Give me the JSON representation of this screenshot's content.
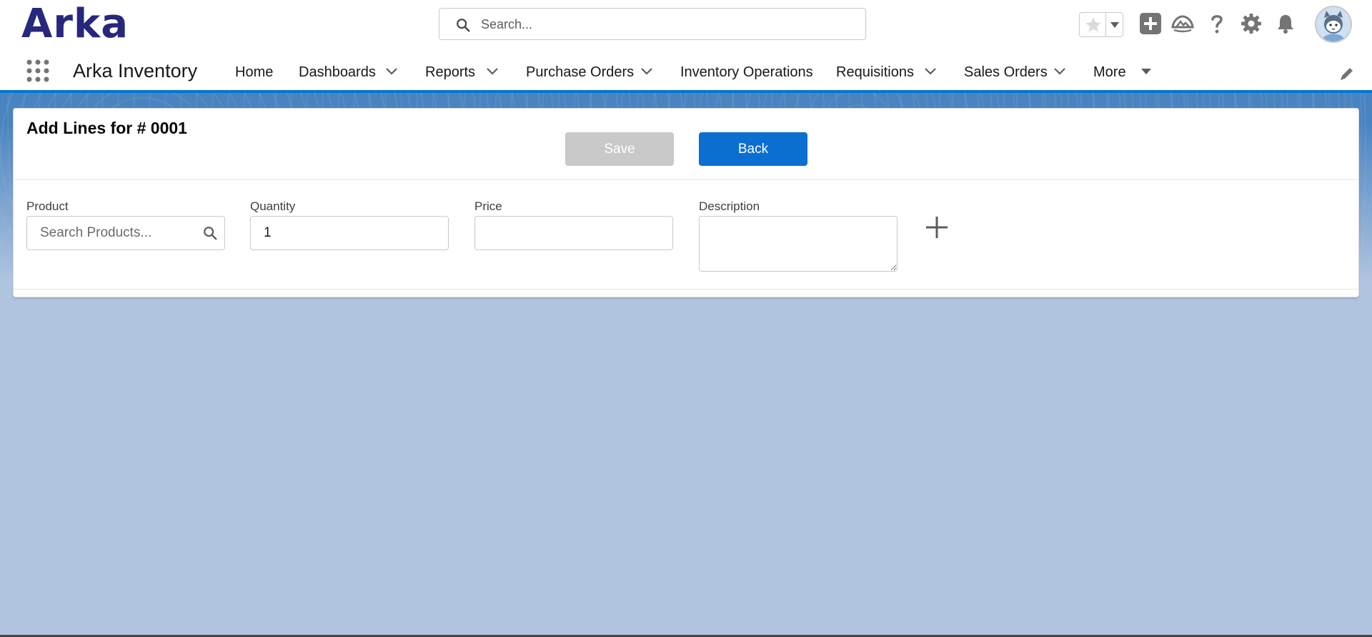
{
  "header": {
    "logo_text": "Arka",
    "search_placeholder": "Search...",
    "icons": [
      "star-icon",
      "chevron-down-icon",
      "add-icon",
      "trailhead-icon",
      "help-icon",
      "gear-icon",
      "bell-icon",
      "avatar"
    ]
  },
  "nav": {
    "app_name": "Arka Inventory",
    "items": [
      {
        "label": "Home",
        "has_menu": false
      },
      {
        "label": "Dashboards",
        "has_menu": true
      },
      {
        "label": "Reports",
        "has_menu": true
      },
      {
        "label": "Purchase Orders",
        "has_menu": true
      },
      {
        "label": "Inventory Operations",
        "has_menu": false
      },
      {
        "label": "Requisitions",
        "has_menu": true
      },
      {
        "label": "Sales Orders",
        "has_menu": true
      },
      {
        "label": "More",
        "has_menu": true
      }
    ]
  },
  "card": {
    "title": "Add Lines for # 0001",
    "save_label": "Save",
    "back_label": "Back",
    "fields": {
      "product": {
        "label": "Product",
        "placeholder": "Search Products...",
        "value": ""
      },
      "quantity": {
        "label": "Quantity",
        "value": "1"
      },
      "price": {
        "label": "Price",
        "value": ""
      },
      "description": {
        "label": "Description",
        "value": ""
      }
    }
  },
  "colors": {
    "brand_blue": "#0b6fd2",
    "logo_navy": "#27277d",
    "page_background": "#b0c4df",
    "disabled_button": "#c9c9c9"
  }
}
